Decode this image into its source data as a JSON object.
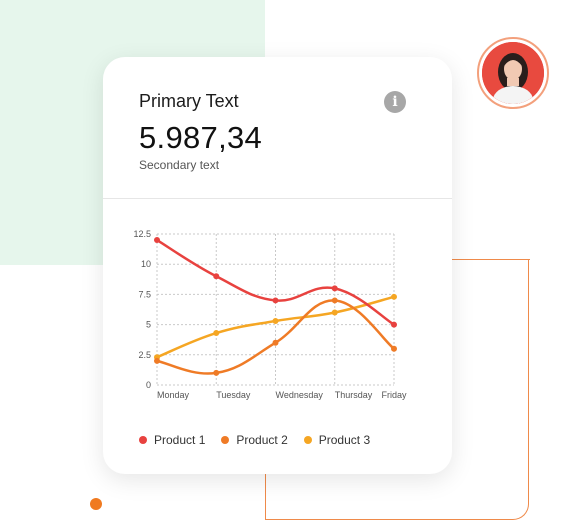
{
  "card": {
    "title": "Primary Text",
    "value": "5.987,34",
    "subtitle": "Secondary text"
  },
  "colors": {
    "product1": "#e8423f",
    "product2": "#ef7b26",
    "product3": "#f5a623",
    "accent": "#f07a20"
  },
  "chart_data": {
    "type": "line",
    "categories": [
      "Monday",
      "Tuesday",
      "Wednesday",
      "Thursday",
      "Friday"
    ],
    "y_ticks": [
      "12.5",
      "10",
      "7.5",
      "5",
      "2.5",
      "0"
    ],
    "ylim": [
      0,
      12.5
    ],
    "grid": true,
    "legend_position": "bottom",
    "series": [
      {
        "name": "Product 1",
        "values": [
          12,
          9,
          7,
          8,
          5
        ]
      },
      {
        "name": "Product 2",
        "values": [
          2,
          1,
          3.5,
          7,
          3
        ]
      },
      {
        "name": "Product 3",
        "values": [
          2.3,
          4.3,
          5.3,
          6,
          7.3
        ]
      }
    ]
  }
}
